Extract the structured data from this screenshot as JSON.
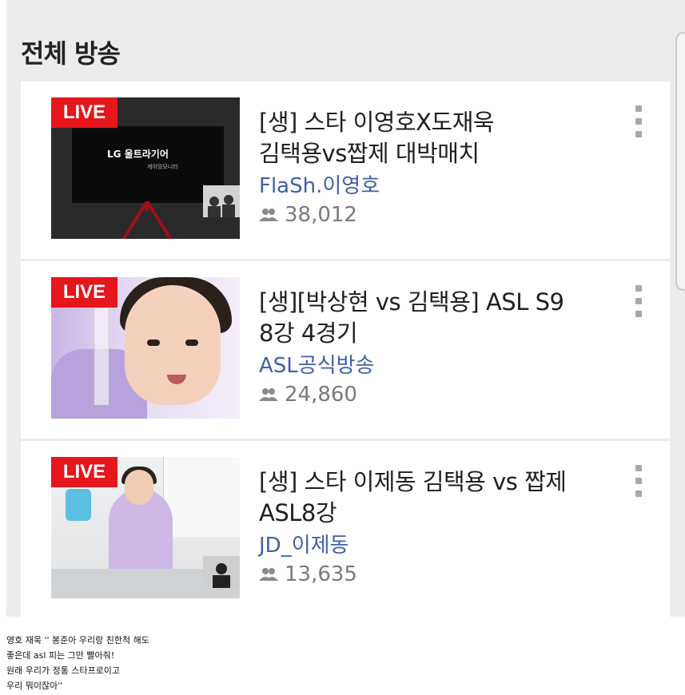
{
  "section": {
    "title": "전체 방송"
  },
  "broadcasts": [
    {
      "badge": "LIVE",
      "title_line1": "[생] 스타 이영호X도재욱",
      "title_line2": "김택용vs짭제 대박매치",
      "channel": "FlaSh.이영호",
      "viewers": "38,012"
    },
    {
      "badge": "LIVE",
      "title_line1": "[생][박상현 vs 김택용] ASL S9",
      "title_line2": "8강 4경기",
      "channel": "ASL공식방송",
      "viewers": "24,860"
    },
    {
      "badge": "LIVE",
      "title_line1": "[생] 스타 이제동 김택용 vs 짭제",
      "title_line2": "ASL8강",
      "channel": "JD_이제동",
      "viewers": "13,635"
    }
  ],
  "thumb1": {
    "logo_text": "LG 울트라기어",
    "sub_text": "게이밍모니터"
  },
  "caption": {
    "lines": [
      "영호 재욱 '' 봉준아 우리랑 친한척 해도",
      "좋은데 asl 피는 그만 빨아줘!",
      "원래 우리가 정통 스타프로이고",
      "우리 뭐이잖아''"
    ]
  },
  "colors": {
    "live_badge": "#e5161c",
    "channel_link": "#3f5fa8",
    "viewers_text": "#7a7a7a",
    "background": "#ececec"
  },
  "icons": {
    "viewers": "people-icon",
    "more": "more-vertical-icon"
  }
}
